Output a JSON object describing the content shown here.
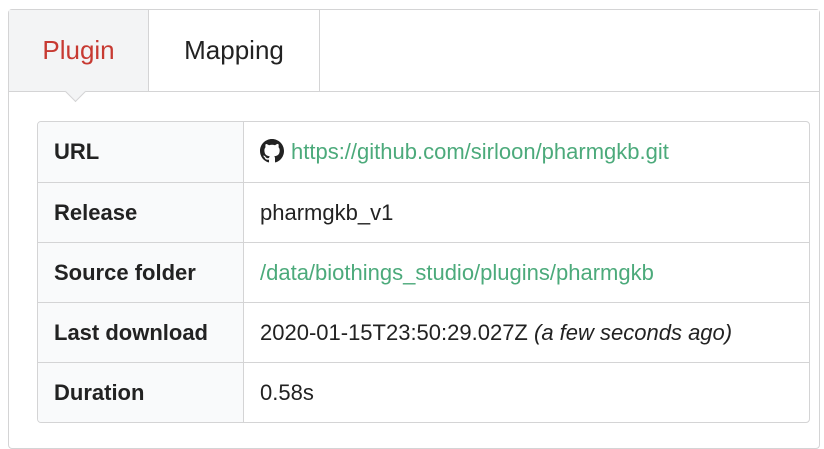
{
  "tabs": [
    {
      "label": "Plugin",
      "active": true
    },
    {
      "label": "Mapping",
      "active": false
    }
  ],
  "colors": {
    "active_tab_text": "#c73a32",
    "link": "#4caa7b",
    "border": "#d4d4d5",
    "key_cell_bg": "#f9fafb"
  },
  "plugin_info": {
    "url": {
      "label": "URL",
      "icon": "github-icon",
      "value": "https://github.com/sirloon/pharmgkb.git"
    },
    "release": {
      "label": "Release",
      "value": "pharmgkb_v1"
    },
    "source_folder": {
      "label": "Source folder",
      "value": "/data/biothings_studio/plugins/pharmgkb"
    },
    "last_download": {
      "label": "Last download",
      "value": "2020-01-15T23:50:29.027Z",
      "relative": "(a few seconds ago)"
    },
    "duration": {
      "label": "Duration",
      "value": "0.58s"
    }
  }
}
